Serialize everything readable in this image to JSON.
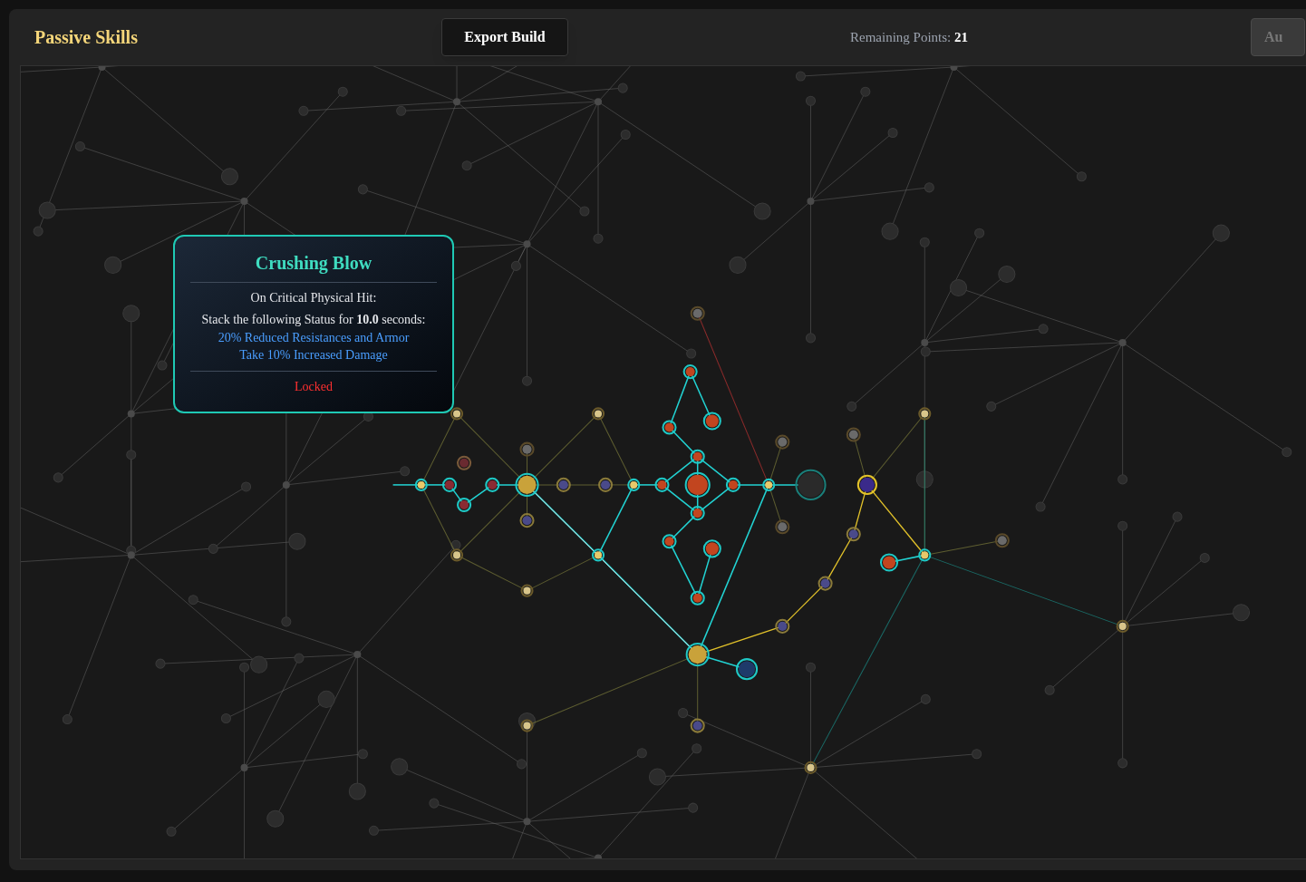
{
  "header": {
    "title": "Passive Skills",
    "export_button": "Export Build",
    "remaining_label": "Remaining Points:",
    "remaining_value": "21",
    "cut_button": "Au"
  },
  "tooltip": {
    "title": "Crushing Blow",
    "trigger": "On Critical Physical Hit:",
    "status_line": "Stack the following Status for **10.0** seconds:",
    "effects": [
      "20% Reduced Resistances and Armor",
      "Take 10% Increased Damage"
    ],
    "state": "Locked"
  }
}
